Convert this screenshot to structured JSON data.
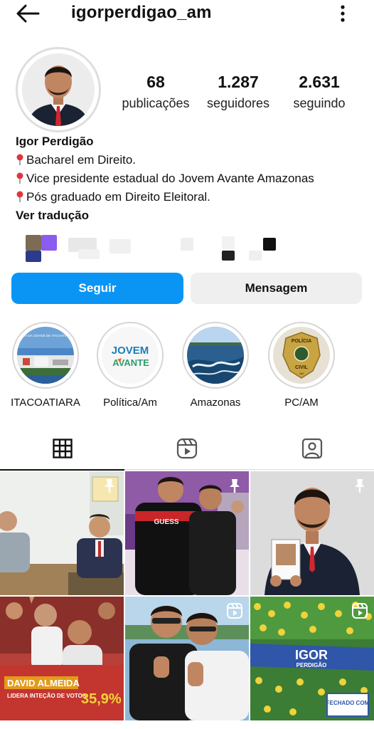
{
  "header": {
    "username": "igorperdigao_am",
    "back_icon": "arrow-left-icon",
    "more_icon": "vertical-ellipsis-icon"
  },
  "profile": {
    "stats": [
      {
        "value": "68",
        "label": "publicações"
      },
      {
        "value": "1.287",
        "label": "seguidores"
      },
      {
        "value": "2.631",
        "label": "seguindo"
      }
    ],
    "name": "Igor Perdigão",
    "bio_lines": [
      "Bacharel em Direito.",
      "Vice presidente estadual do Jovem Avante Amazonas",
      "Pós graduado em Direito Eleitoral."
    ],
    "see_translation": "Ver tradução"
  },
  "actions": {
    "follow_label": "Seguir",
    "message_label": "Mensagem"
  },
  "highlights": [
    {
      "label": "ITACOATIARA",
      "cover_text": "ORLA DA CIDADE DE ITACOATIARA"
    },
    {
      "label": "Política/Am",
      "cover_text_top": "JOVEM",
      "cover_text_bottom": "AVANTE"
    },
    {
      "label": "Amazonas"
    },
    {
      "label": "PC/AM",
      "cover_text_top": "POLÍCIA",
      "cover_text_bottom": "CIVIL",
      "cover_text_small": "AM"
    }
  ],
  "tabs": [
    {
      "name": "grid",
      "icon": "grid-icon",
      "active": true
    },
    {
      "name": "reels",
      "icon": "reels-icon",
      "active": false
    },
    {
      "name": "tagged",
      "icon": "tagged-person-icon",
      "active": false
    }
  ],
  "posts": [
    {
      "type": "image",
      "badge": "pin-icon"
    },
    {
      "type": "image",
      "badge": "pin-icon",
      "shirt_text": "GUESS"
    },
    {
      "type": "image",
      "badge": "pin-icon"
    },
    {
      "type": "image",
      "headline": "DAVID ALMEIDA",
      "subline": "LIDERA INTEÇÃO DE VOTOS",
      "percent": "35,9%"
    },
    {
      "type": "reel",
      "badge": "reels-icon"
    },
    {
      "type": "reel",
      "badge": "reels-icon",
      "banner_text": "IGOR",
      "banner_sub": "PERDIGÃO",
      "sign_text": "FECHADO COM"
    }
  ],
  "colors": {
    "accent": "#0a95f5",
    "secondary_button": "#efefef",
    "divider": "#dbdbdb"
  }
}
